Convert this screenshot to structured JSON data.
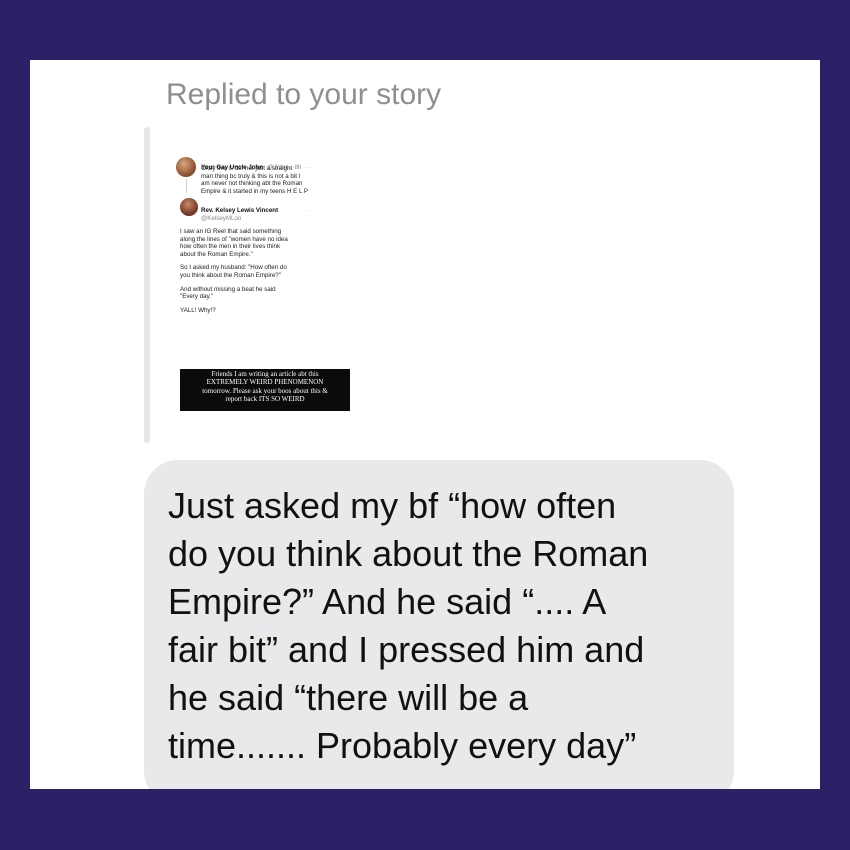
{
  "colors": {
    "frame_bg": "#2b2167",
    "card_bg": "#ffffff",
    "bubble_bg": "#e9e9eb",
    "header_text": "#8e8e93",
    "story_bar": "#e5e5ea"
  },
  "header": {
    "label": "Replied to your story"
  },
  "story": {
    "tweet1": {
      "name": "Your Gay Uncle John",
      "handle": "@John...·8h",
      "more": "···",
      "lines": [
        "Okay this is def not just a straight",
        "man thing bc truly & this is not a bit I",
        "am never not thinking abt the Roman",
        "Empire & it started in my teens H E L P"
      ]
    },
    "tweet2": {
      "name": "Rev. Kelsey Lewis Vincent",
      "handle": "@KelseyMLoo",
      "more": "···",
      "lines": [
        "I saw an IG Reel that said something",
        "along the lines of \"women have no idea",
        "how often the men in their lives think",
        "about the Roman Empire.\"",
        "",
        "So I asked my husband: \"How often do",
        "you think about the Roman Empire?\"",
        "",
        "And without missing a beat he said",
        "\"Every day.\"",
        "",
        "YALL! Why!?"
      ]
    },
    "caption_lines": [
      "Friends I am writing an article abt this",
      "EXTREMELY WEIRD PHENOMENON",
      "tomorrow. Please ask your boos about this &",
      "report back ITS SO WEIRD"
    ]
  },
  "message": {
    "lines": [
      "Just asked my bf “how often",
      "do you think about the Roman",
      "Empire?” And he said “.... A",
      "fair bit” and I pressed him and",
      "he said “there will be a",
      "time....... Probably every day”"
    ]
  }
}
